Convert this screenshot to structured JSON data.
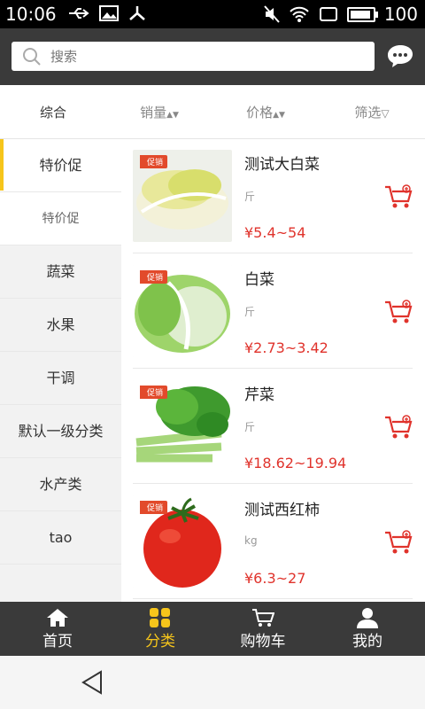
{
  "status_bar": {
    "time": "10:06",
    "battery": "100"
  },
  "search": {
    "placeholder": "搜索"
  },
  "sort_tabs": [
    "综合",
    "销量",
    "价格",
    "筛选"
  ],
  "categories": [
    "特价促",
    "特价促",
    "蔬菜",
    "水果",
    "干调",
    "默认一级分类",
    "水产类",
    "tao"
  ],
  "promo_badge": "促销",
  "products": [
    {
      "name": "测试大白菜",
      "unit": "斤",
      "price": "¥5.4~54"
    },
    {
      "name": "白菜",
      "unit": "斤",
      "price": "¥2.73~3.42"
    },
    {
      "name": "芹菜",
      "unit": "斤",
      "price": "¥18.62~19.94"
    },
    {
      "name": "测试西红柿",
      "unit": "kg",
      "price": "¥6.3~27"
    }
  ],
  "bottom_nav": [
    "首页",
    "分类",
    "购物车",
    "我的"
  ],
  "colors": {
    "accent": "#f6c51b",
    "price": "#e0332c",
    "bar": "#3a3a3a"
  }
}
